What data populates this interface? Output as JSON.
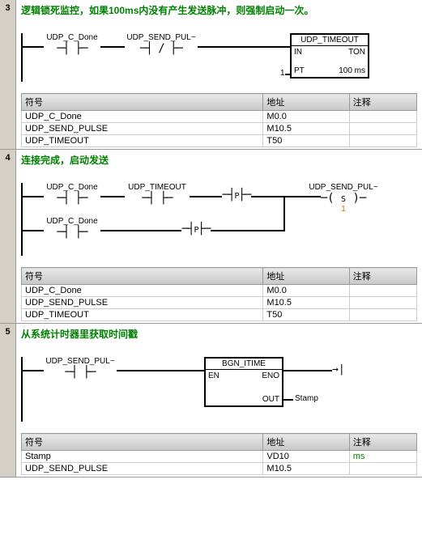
{
  "headers": {
    "symbol": "符号",
    "address": "地址",
    "comment": "注释"
  },
  "rungs": [
    {
      "num": "3",
      "title": "逻辑锁死监控，如果100ms内没有产生发送脉冲，则强制启动一次。",
      "labels": {
        "c1": "UDP_C_Done",
        "c2": "UDP_SEND_PUL~",
        "block": "UDP_TIMEOUT",
        "in": "IN",
        "ton": "TON",
        "pt": "PT",
        "ptv": "100 ms",
        "one": "1"
      },
      "table": [
        {
          "s": "UDP_C_Done",
          "a": "M0.0",
          "c": ""
        },
        {
          "s": "UDP_SEND_PULSE",
          "a": "M10.5",
          "c": ""
        },
        {
          "s": "UDP_TIMEOUT",
          "a": "T50",
          "c": ""
        }
      ]
    },
    {
      "num": "4",
      "title": "连接完成，启动发送",
      "labels": {
        "c1": "UDP_C_Done",
        "c2": "UDP_TIMEOUT",
        "c3": "UDP_C_Done",
        "p": "P",
        "coil": "UDP_SEND_PUL~",
        "s": "S",
        "one": "1"
      },
      "table": [
        {
          "s": "UDP_C_Done",
          "a": "M0.0",
          "c": ""
        },
        {
          "s": "UDP_SEND_PULSE",
          "a": "M10.5",
          "c": ""
        },
        {
          "s": "UDP_TIMEOUT",
          "a": "T50",
          "c": ""
        }
      ]
    },
    {
      "num": "5",
      "title": "从系统计时器里获取时间戳",
      "labels": {
        "c1": "UDP_SEND_PUL~",
        "block": "BGN_ITIME",
        "en": "EN",
        "eno": "ENO",
        "out": "OUT",
        "outv": "Stamp"
      },
      "table": [
        {
          "s": "Stamp",
          "a": "VD10",
          "c": "ms"
        },
        {
          "s": "UDP_SEND_PULSE",
          "a": "M10.5",
          "c": ""
        }
      ]
    }
  ]
}
